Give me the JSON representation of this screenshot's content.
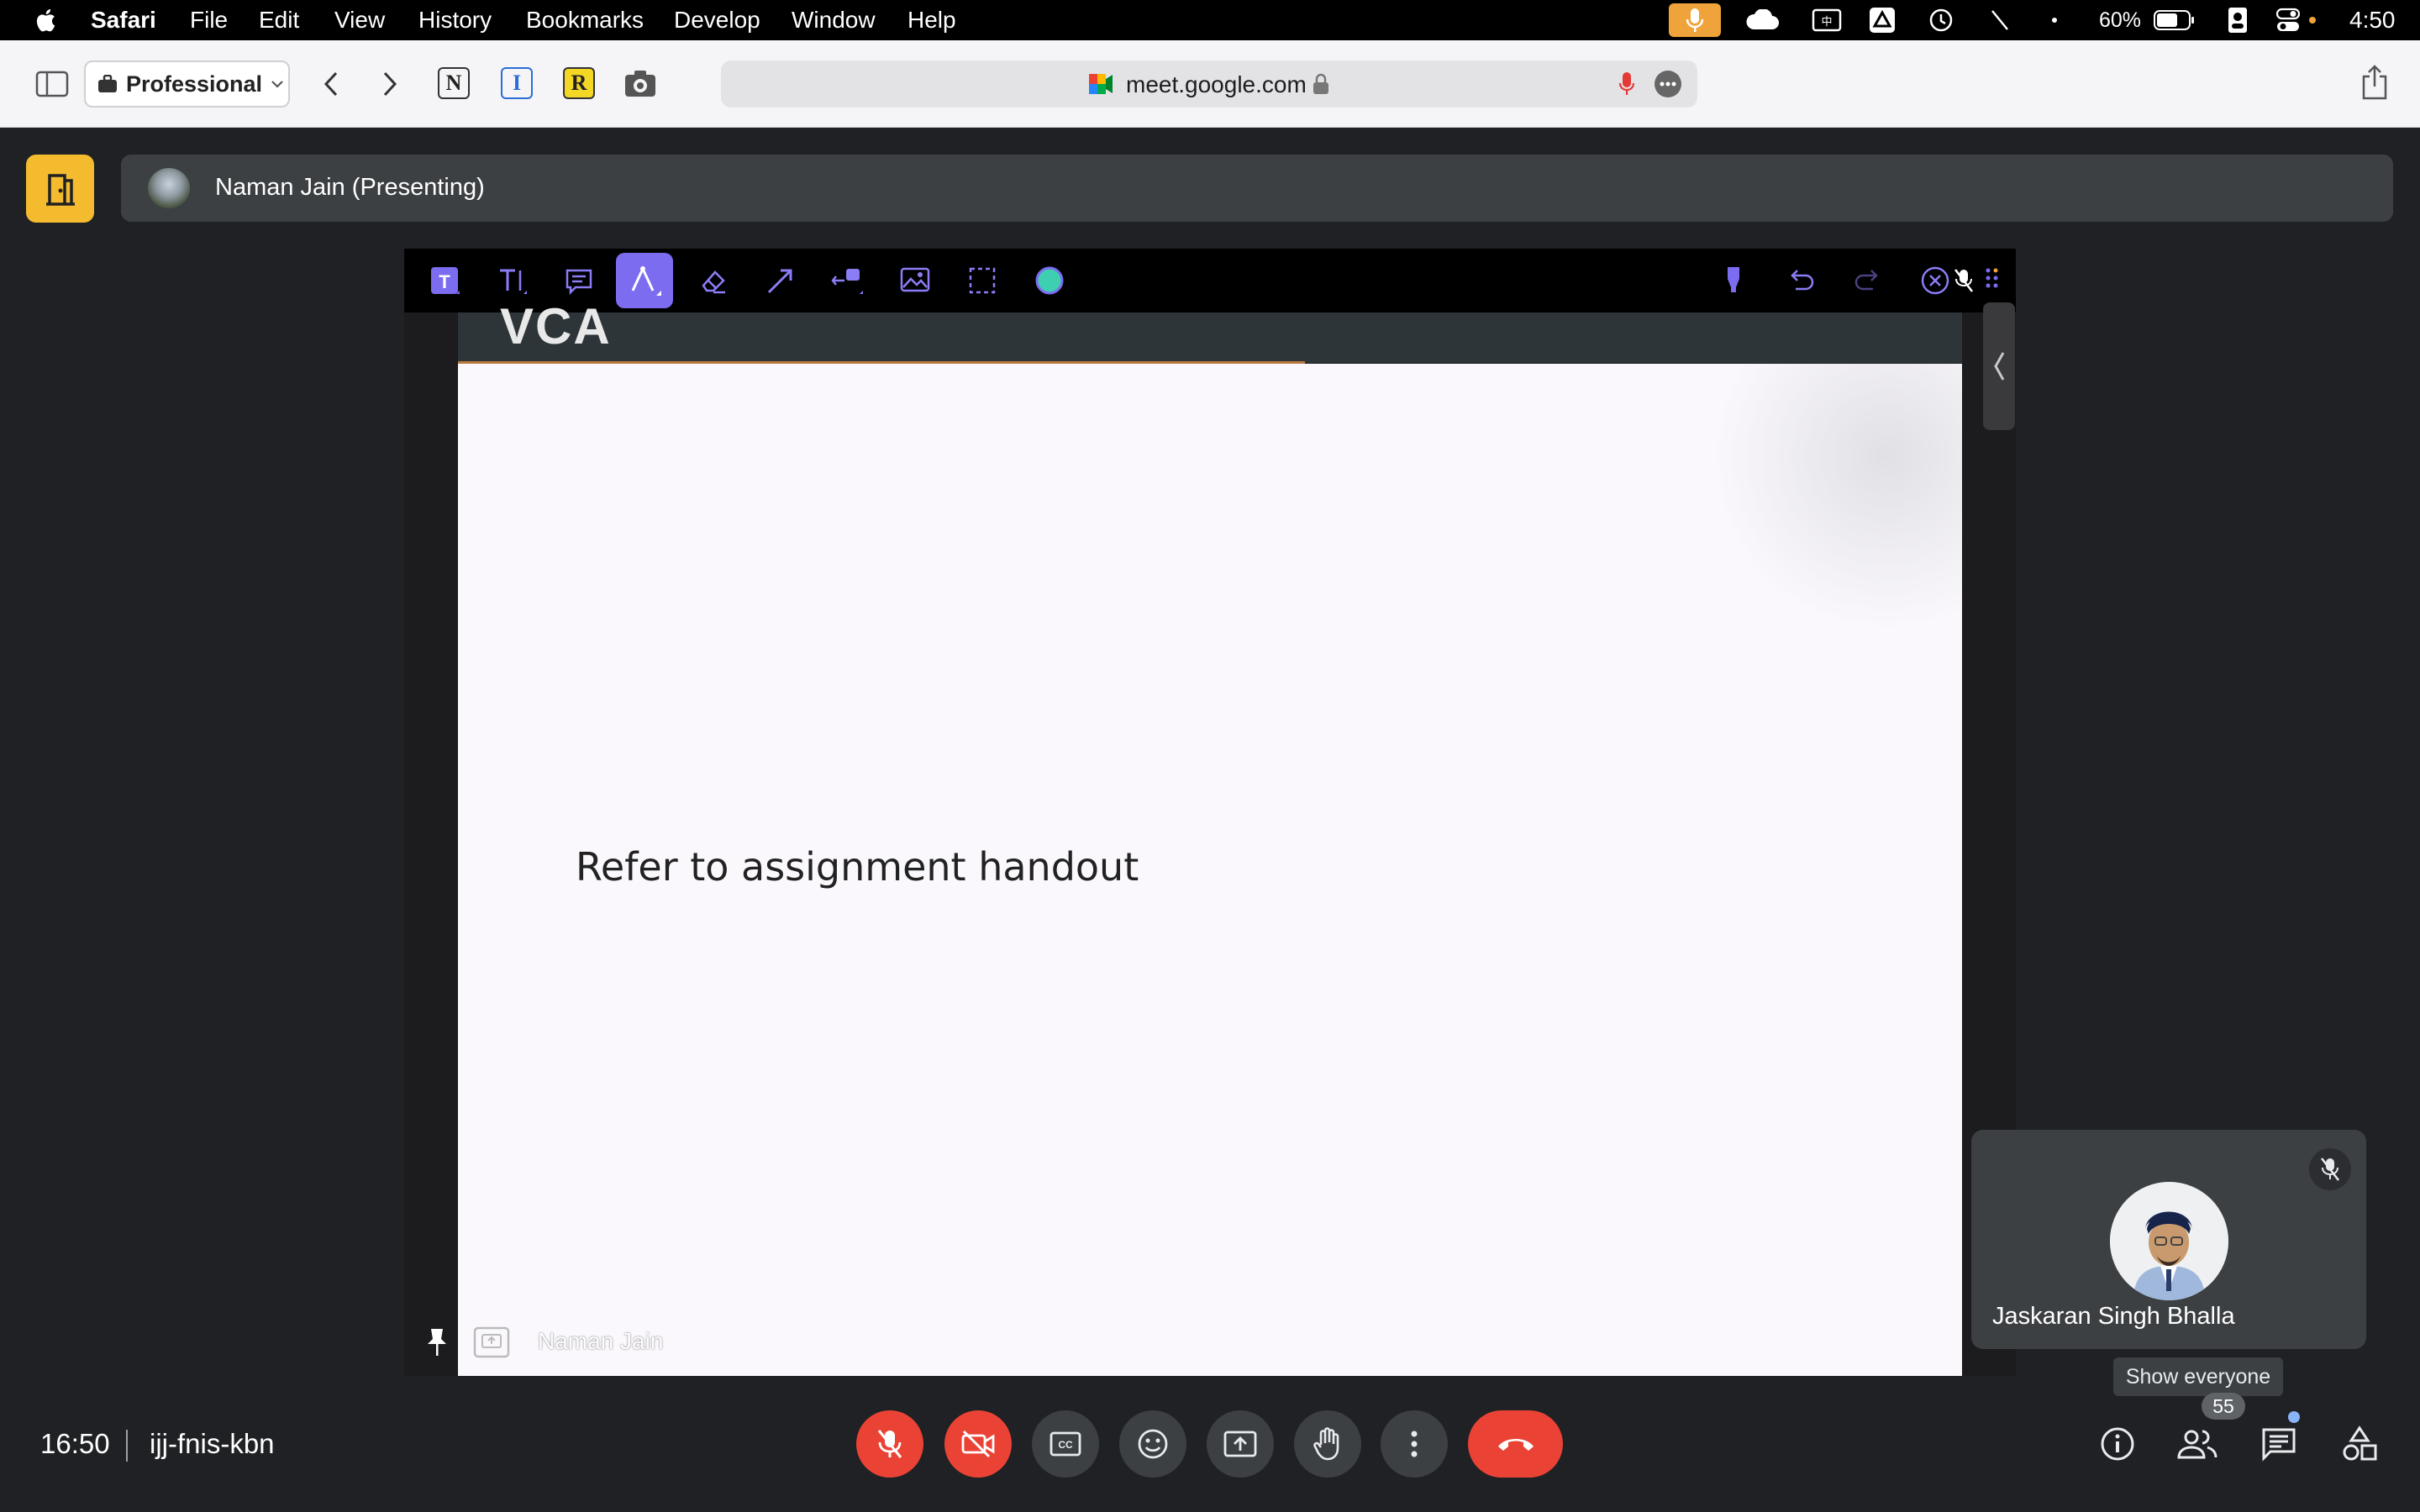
{
  "menubar": {
    "app_name": "Safari",
    "items": [
      "File",
      "Edit",
      "View",
      "History",
      "Bookmarks",
      "Develop",
      "Window",
      "Help"
    ],
    "battery_percent": "60%",
    "clock": "4:50"
  },
  "browser": {
    "profile_label": "Professional",
    "url": "meet.google.com",
    "extensions": [
      "N",
      "I",
      "R"
    ]
  },
  "meet": {
    "presenter_label": "Naman Jain (Presenting)",
    "tile_label": "Naman Jain",
    "self_name": "Jaskaran Singh Bhalla",
    "tooltip": "Show everyone",
    "participant_count": "55",
    "time": "16:50",
    "meeting_code": "ijj-fnis-kbn"
  },
  "slide": {
    "header_text": "VCA",
    "body_text": "Refer to assignment handout"
  },
  "colors": {
    "accent_yellow": "#f4bb2f",
    "danger_red": "#ea4335",
    "annotation_purple": "#7b6cf0",
    "meet_bg": "#202124"
  }
}
